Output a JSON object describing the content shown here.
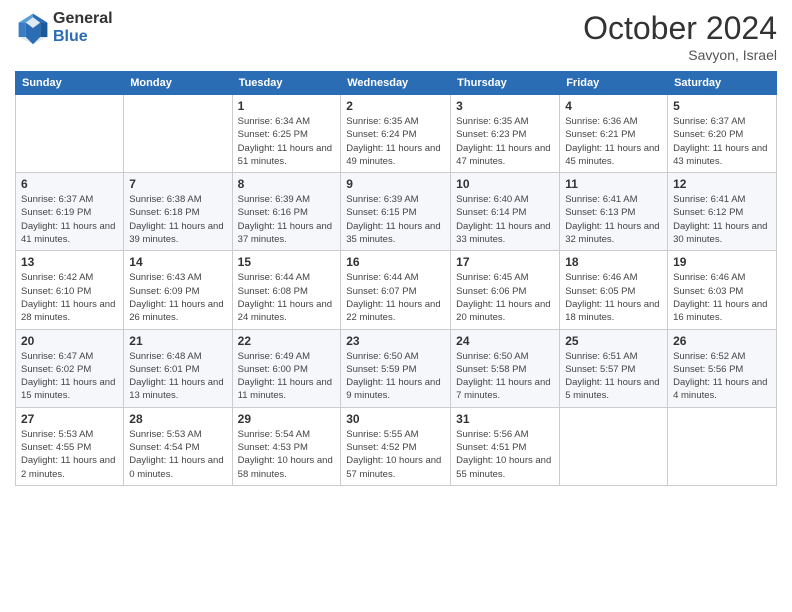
{
  "logo": {
    "general": "General",
    "blue": "Blue"
  },
  "title": "October 2024",
  "location": "Savyon, Israel",
  "days_header": [
    "Sunday",
    "Monday",
    "Tuesday",
    "Wednesday",
    "Thursday",
    "Friday",
    "Saturday"
  ],
  "weeks": [
    [
      {
        "day": "",
        "info": ""
      },
      {
        "day": "",
        "info": ""
      },
      {
        "day": "1",
        "info": "Sunrise: 6:34 AM\nSunset: 6:25 PM\nDaylight: 11 hours and 51 minutes."
      },
      {
        "day": "2",
        "info": "Sunrise: 6:35 AM\nSunset: 6:24 PM\nDaylight: 11 hours and 49 minutes."
      },
      {
        "day": "3",
        "info": "Sunrise: 6:35 AM\nSunset: 6:23 PM\nDaylight: 11 hours and 47 minutes."
      },
      {
        "day": "4",
        "info": "Sunrise: 6:36 AM\nSunset: 6:21 PM\nDaylight: 11 hours and 45 minutes."
      },
      {
        "day": "5",
        "info": "Sunrise: 6:37 AM\nSunset: 6:20 PM\nDaylight: 11 hours and 43 minutes."
      }
    ],
    [
      {
        "day": "6",
        "info": "Sunrise: 6:37 AM\nSunset: 6:19 PM\nDaylight: 11 hours and 41 minutes."
      },
      {
        "day": "7",
        "info": "Sunrise: 6:38 AM\nSunset: 6:18 PM\nDaylight: 11 hours and 39 minutes."
      },
      {
        "day": "8",
        "info": "Sunrise: 6:39 AM\nSunset: 6:16 PM\nDaylight: 11 hours and 37 minutes."
      },
      {
        "day": "9",
        "info": "Sunrise: 6:39 AM\nSunset: 6:15 PM\nDaylight: 11 hours and 35 minutes."
      },
      {
        "day": "10",
        "info": "Sunrise: 6:40 AM\nSunset: 6:14 PM\nDaylight: 11 hours and 33 minutes."
      },
      {
        "day": "11",
        "info": "Sunrise: 6:41 AM\nSunset: 6:13 PM\nDaylight: 11 hours and 32 minutes."
      },
      {
        "day": "12",
        "info": "Sunrise: 6:41 AM\nSunset: 6:12 PM\nDaylight: 11 hours and 30 minutes."
      }
    ],
    [
      {
        "day": "13",
        "info": "Sunrise: 6:42 AM\nSunset: 6:10 PM\nDaylight: 11 hours and 28 minutes."
      },
      {
        "day": "14",
        "info": "Sunrise: 6:43 AM\nSunset: 6:09 PM\nDaylight: 11 hours and 26 minutes."
      },
      {
        "day": "15",
        "info": "Sunrise: 6:44 AM\nSunset: 6:08 PM\nDaylight: 11 hours and 24 minutes."
      },
      {
        "day": "16",
        "info": "Sunrise: 6:44 AM\nSunset: 6:07 PM\nDaylight: 11 hours and 22 minutes."
      },
      {
        "day": "17",
        "info": "Sunrise: 6:45 AM\nSunset: 6:06 PM\nDaylight: 11 hours and 20 minutes."
      },
      {
        "day": "18",
        "info": "Sunrise: 6:46 AM\nSunset: 6:05 PM\nDaylight: 11 hours and 18 minutes."
      },
      {
        "day": "19",
        "info": "Sunrise: 6:46 AM\nSunset: 6:03 PM\nDaylight: 11 hours and 16 minutes."
      }
    ],
    [
      {
        "day": "20",
        "info": "Sunrise: 6:47 AM\nSunset: 6:02 PM\nDaylight: 11 hours and 15 minutes."
      },
      {
        "day": "21",
        "info": "Sunrise: 6:48 AM\nSunset: 6:01 PM\nDaylight: 11 hours and 13 minutes."
      },
      {
        "day": "22",
        "info": "Sunrise: 6:49 AM\nSunset: 6:00 PM\nDaylight: 11 hours and 11 minutes."
      },
      {
        "day": "23",
        "info": "Sunrise: 6:50 AM\nSunset: 5:59 PM\nDaylight: 11 hours and 9 minutes."
      },
      {
        "day": "24",
        "info": "Sunrise: 6:50 AM\nSunset: 5:58 PM\nDaylight: 11 hours and 7 minutes."
      },
      {
        "day": "25",
        "info": "Sunrise: 6:51 AM\nSunset: 5:57 PM\nDaylight: 11 hours and 5 minutes."
      },
      {
        "day": "26",
        "info": "Sunrise: 6:52 AM\nSunset: 5:56 PM\nDaylight: 11 hours and 4 minutes."
      }
    ],
    [
      {
        "day": "27",
        "info": "Sunrise: 5:53 AM\nSunset: 4:55 PM\nDaylight: 11 hours and 2 minutes."
      },
      {
        "day": "28",
        "info": "Sunrise: 5:53 AM\nSunset: 4:54 PM\nDaylight: 11 hours and 0 minutes."
      },
      {
        "day": "29",
        "info": "Sunrise: 5:54 AM\nSunset: 4:53 PM\nDaylight: 10 hours and 58 minutes."
      },
      {
        "day": "30",
        "info": "Sunrise: 5:55 AM\nSunset: 4:52 PM\nDaylight: 10 hours and 57 minutes."
      },
      {
        "day": "31",
        "info": "Sunrise: 5:56 AM\nSunset: 4:51 PM\nDaylight: 10 hours and 55 minutes."
      },
      {
        "day": "",
        "info": ""
      },
      {
        "day": "",
        "info": ""
      }
    ]
  ]
}
